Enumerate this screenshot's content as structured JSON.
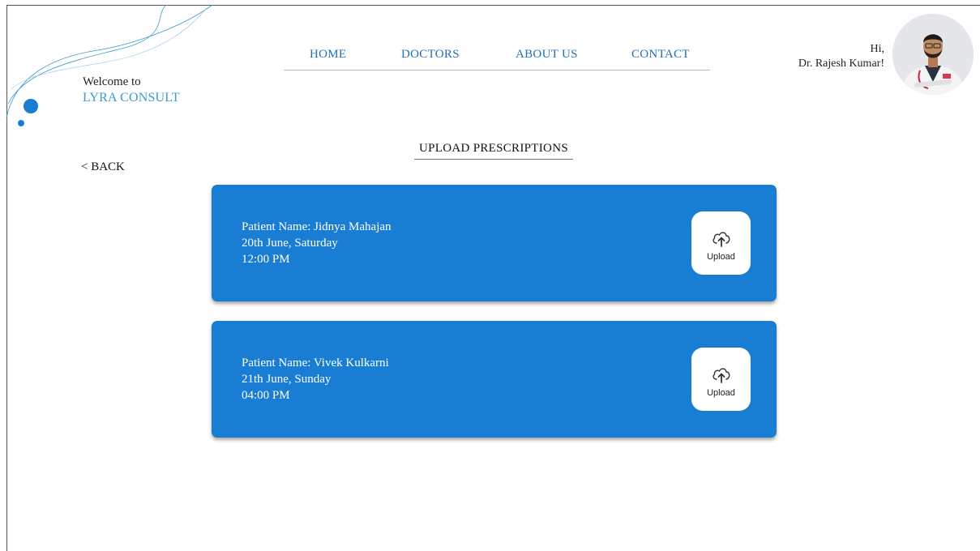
{
  "brand": {
    "welcome": "Welcome to",
    "name": "LYRA CONSULT"
  },
  "nav": [
    {
      "label": "HOME"
    },
    {
      "label": "DOCTORS"
    },
    {
      "label": "ABOUT US"
    },
    {
      "label": "CONTACT"
    }
  ],
  "user": {
    "greeting": "Hi,",
    "name": "Dr. Rajesh Kumar!"
  },
  "back_label": "< BACK",
  "page_title": "UPLOAD PRESCRIPTIONS",
  "appointments": [
    {
      "patient": "Patient Name: Jidnya Mahajan",
      "date": "20th June, Saturday",
      "time": "12:00 PM",
      "upload_label": "Upload"
    },
    {
      "patient": "Patient Name: Vivek Kulkarni",
      "date": "21th June, Sunday",
      "time": "04:00 PM",
      "upload_label": "Upload"
    }
  ],
  "colors": {
    "card_bg": "#1a7dd4",
    "nav_link": "#1f6fb8",
    "brand_accent": "#3a9bd0"
  },
  "icons": {
    "upload": "cloud-upload-icon",
    "avatar": "doctor-avatar"
  }
}
